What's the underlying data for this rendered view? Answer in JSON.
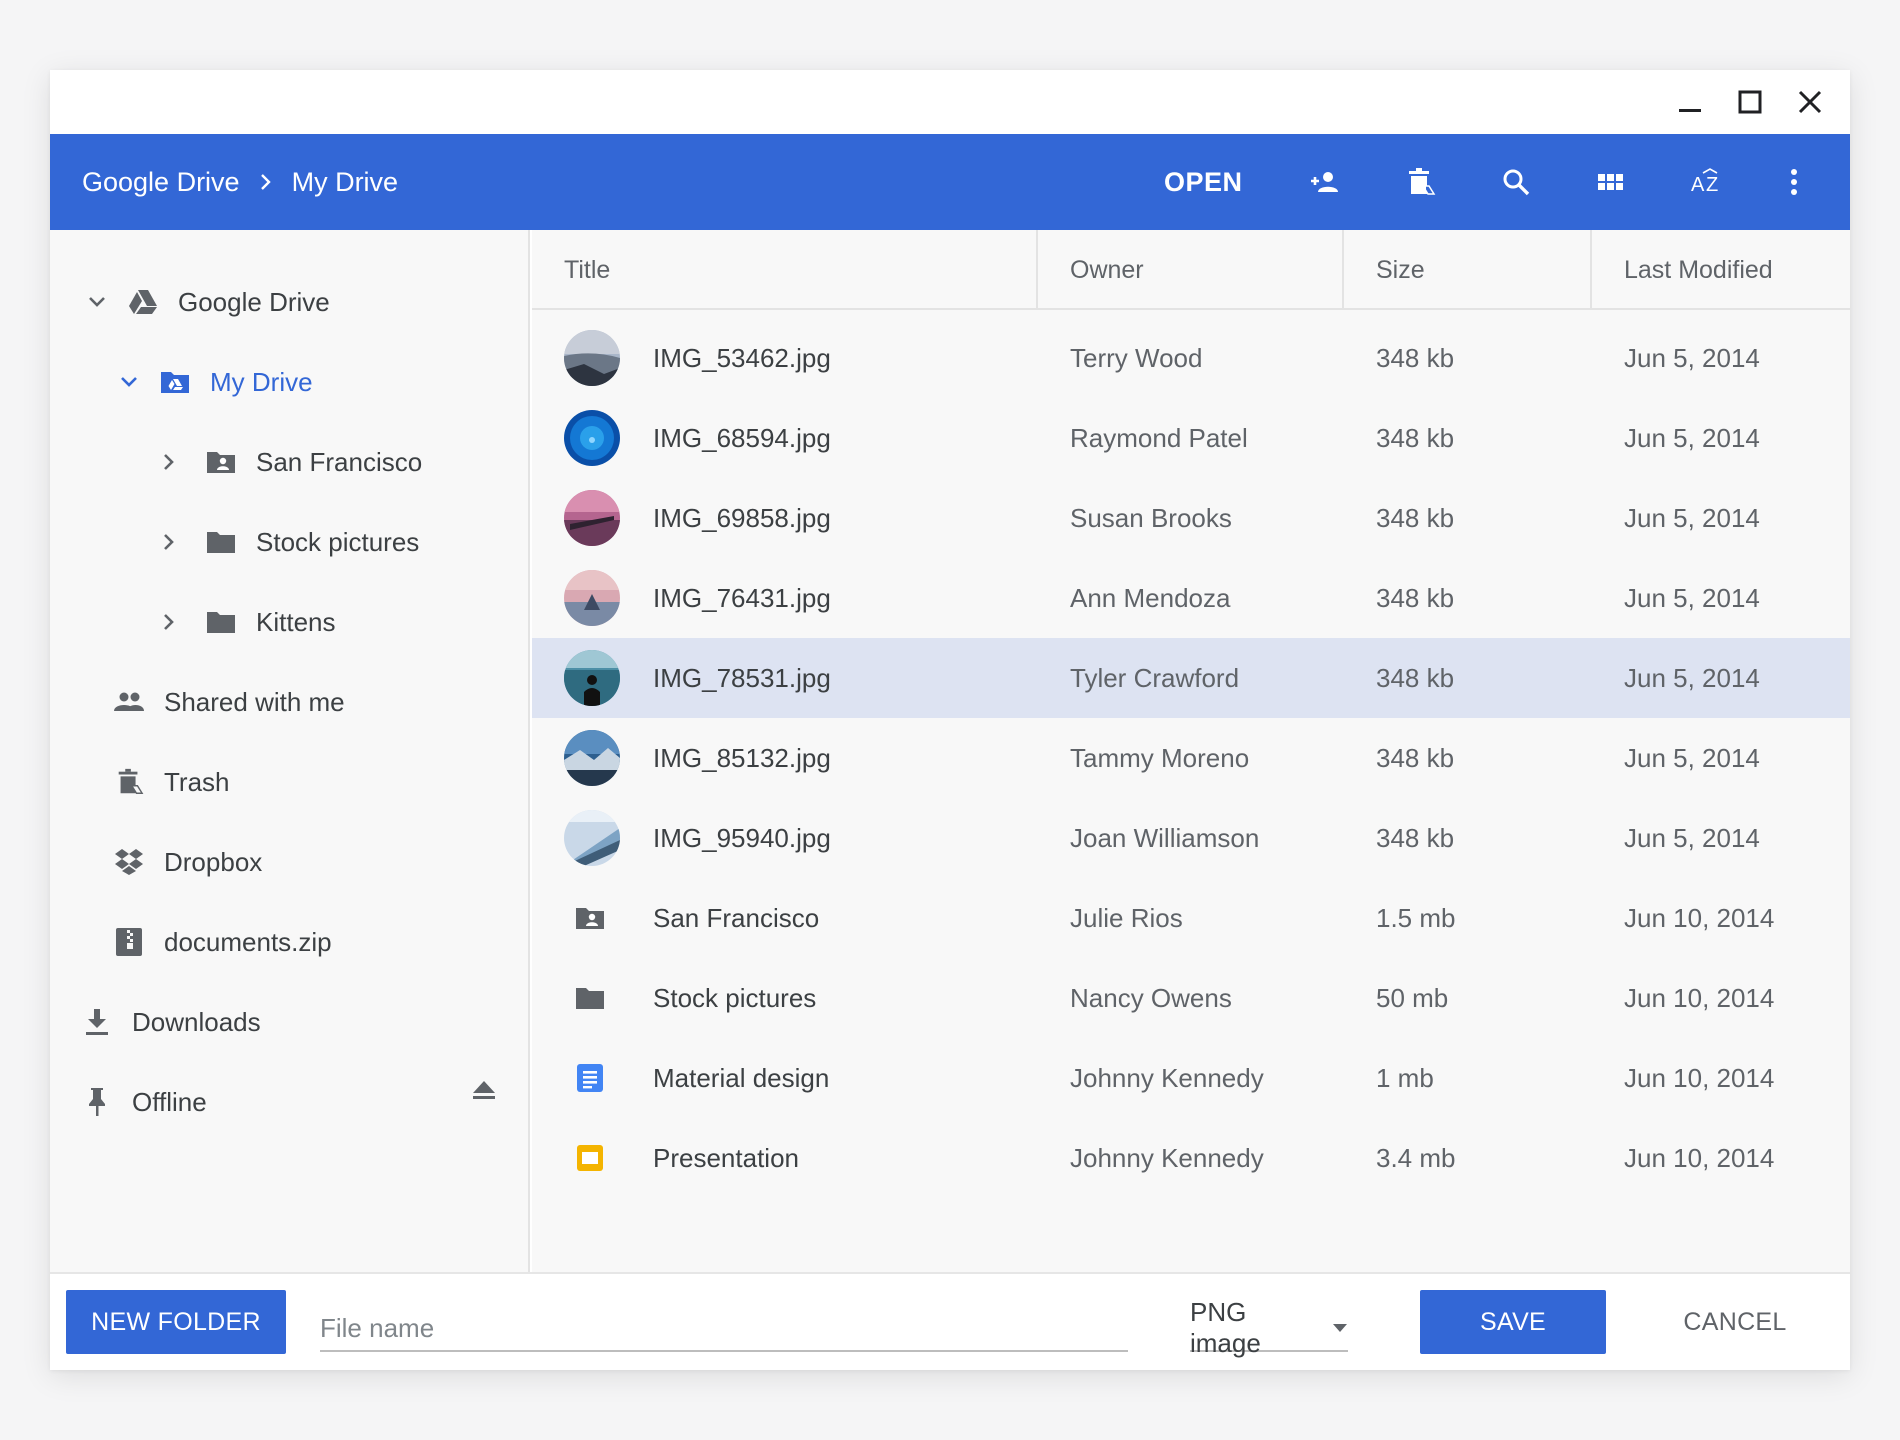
{
  "window_controls": {
    "minimize": "minimize-icon",
    "maximize": "maximize-icon",
    "close": "close-icon"
  },
  "toolbar": {
    "breadcrumb": [
      "Google Drive",
      "My Drive"
    ],
    "open_label": "OPEN",
    "icons": [
      "add-person-icon",
      "drive-trash-icon",
      "search-icon",
      "grid-view-icon",
      "sort-az-icon",
      "more-vert-icon"
    ],
    "accent": "#3367d6"
  },
  "sidebar": {
    "items": [
      {
        "label": "Google Drive",
        "icon": "google-drive-icon",
        "expanded": true
      },
      {
        "label": "My Drive",
        "icon": "my-drive-folder-icon",
        "expanded": true,
        "active": true
      },
      {
        "label": "San Francisco",
        "icon": "shared-folder-icon"
      },
      {
        "label": "Stock pictures",
        "icon": "folder-icon"
      },
      {
        "label": "Kittens",
        "icon": "folder-icon"
      },
      {
        "label": "Shared with me",
        "icon": "people-icon"
      },
      {
        "label": "Trash",
        "icon": "drive-trash-icon"
      },
      {
        "label": "Dropbox",
        "icon": "dropbox-icon"
      },
      {
        "label": "documents.zip",
        "icon": "zip-icon",
        "action": "eject-icon"
      },
      {
        "label": "Downloads",
        "icon": "download-icon"
      },
      {
        "label": "Offline",
        "icon": "pin-icon"
      }
    ]
  },
  "table": {
    "columns": [
      "Title",
      "Owner",
      "Size",
      "Last Modified"
    ],
    "rows": [
      {
        "title": "IMG_53462.jpg",
        "owner": "Terry Wood",
        "size": "348 kb",
        "modified": "Jun 5, 2014",
        "kind": "image"
      },
      {
        "title": "IMG_68594.jpg",
        "owner": "Raymond Patel",
        "size": "348 kb",
        "modified": "Jun 5, 2014",
        "kind": "image"
      },
      {
        "title": "IMG_69858.jpg",
        "owner": "Susan Brooks",
        "size": "348 kb",
        "modified": "Jun 5, 2014",
        "kind": "image"
      },
      {
        "title": "IMG_76431.jpg",
        "owner": "Ann Mendoza",
        "size": "348 kb",
        "modified": "Jun 5, 2014",
        "kind": "image"
      },
      {
        "title": "IMG_78531.jpg",
        "owner": "Tyler Crawford",
        "size": "348 kb",
        "modified": "Jun 5, 2014",
        "kind": "image",
        "selected": true
      },
      {
        "title": "IMG_85132.jpg",
        "owner": "Tammy Moreno",
        "size": "348 kb",
        "modified": "Jun 5, 2014",
        "kind": "image"
      },
      {
        "title": "IMG_95940.jpg",
        "owner": "Joan Williamson",
        "size": "348 kb",
        "modified": "Jun 5, 2014",
        "kind": "image"
      },
      {
        "title": "San Francisco",
        "owner": "Julie Rios",
        "size": "1.5 mb",
        "modified": "Jun 10, 2014",
        "kind": "shared-folder"
      },
      {
        "title": "Stock pictures",
        "owner": "Nancy Owens",
        "size": "50 mb",
        "modified": "Jun 10, 2014",
        "kind": "folder"
      },
      {
        "title": "Material design",
        "owner": "Johnny Kennedy",
        "size": "1 mb",
        "modified": "Jun 10, 2014",
        "kind": "doc"
      },
      {
        "title": "Presentation",
        "owner": "Johnny Kennedy",
        "size": "3.4 mb",
        "modified": "Jun 10, 2014",
        "kind": "slides"
      }
    ]
  },
  "footer": {
    "new_folder_label": "NEW FOLDER",
    "filename_placeholder": "File name",
    "filename_value": "",
    "file_type": "PNG image",
    "save_label": "SAVE",
    "cancel_label": "CANCEL"
  }
}
